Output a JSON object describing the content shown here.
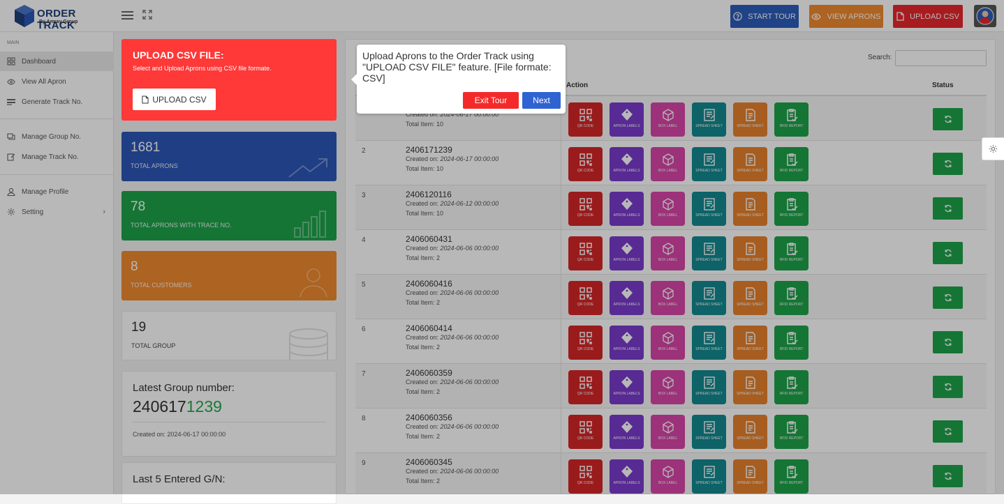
{
  "brand": {
    "title": "ORDER TRACK",
    "subtitle": "By Amray Group"
  },
  "topbar": {
    "start_tour": "START TOUR",
    "view_aprons": "VIEW APRONS",
    "upload_csv": "UPLOAD CSV",
    "colors": {
      "start": "#2b5dba",
      "view": "#f08a2e",
      "upload": "#e8272d"
    }
  },
  "sidebar": {
    "section": "MAIN",
    "items": [
      {
        "label": "Dashboard",
        "icon": "grid-icon"
      },
      {
        "label": "View All Apron",
        "icon": "eye-icon"
      },
      {
        "label": "Generate Track No.",
        "icon": "list-icon"
      },
      {
        "label": "Manage Group No.",
        "icon": "layers-icon"
      },
      {
        "label": "Manage Track No.",
        "icon": "edit-icon"
      },
      {
        "label": "Manage Profile",
        "icon": "user-icon"
      },
      {
        "label": "Setting",
        "icon": "gear-icon"
      }
    ]
  },
  "upload_card": {
    "title": "UPLOAD CSV FILE:",
    "subtitle": "Select and Upload Aprons using CSV file formate.",
    "button": "UPLOAD CSV"
  },
  "stats": [
    {
      "value": "1681",
      "label": "TOTAL APRONS",
      "color": "#2d56b8"
    },
    {
      "value": "78",
      "label": "TOTAL APRONS WITH TRACE NO.",
      "color": "#1ea34a"
    },
    {
      "value": "8",
      "label": "TOTAL CUSTOMERS",
      "color": "#f08a2e"
    },
    {
      "value": "19",
      "label": "TOTAL GROUP",
      "color": "#ffffff"
    }
  ],
  "latest_group": {
    "title": "Latest Group number:",
    "prefix": "240617",
    "suffix": "1239",
    "created": "Created on: 2024-06-17 00:00:00"
  },
  "last_five": {
    "title": "Last 5 Entered G/N:"
  },
  "table": {
    "search_label": "Search:",
    "search_value": "",
    "headers": {
      "action": "Action",
      "status": "Status"
    },
    "action_labels": [
      "QR CODE",
      "APRON LABELS",
      "BOX LABEL",
      "SPREAD SHEET",
      "SPREAD SHEET",
      "RFID REPORT"
    ],
    "created_prefix": "Created on: ",
    "total_prefix": "Total Item: ",
    "rows": [
      {
        "idx": "",
        "group": "",
        "created": "2024-06-17 00:00:00",
        "total": "10"
      },
      {
        "idx": "2",
        "group": "2406171239",
        "created": "2024-06-17 00:00:00",
        "total": "10"
      },
      {
        "idx": "3",
        "group": "2406120116",
        "created": "2024-06-12 00:00:00",
        "total": "10"
      },
      {
        "idx": "4",
        "group": "2406060431",
        "created": "2024-06-06 00:00:00",
        "total": "2"
      },
      {
        "idx": "5",
        "group": "2406060416",
        "created": "2024-06-06 00:00:00",
        "total": "2"
      },
      {
        "idx": "6",
        "group": "2406060414",
        "created": "2024-06-06 00:00:00",
        "total": "2"
      },
      {
        "idx": "7",
        "group": "2406060359",
        "created": "2024-06-06 00:00:00",
        "total": "2"
      },
      {
        "idx": "8",
        "group": "2406060356",
        "created": "2024-06-06 00:00:00",
        "total": "2"
      },
      {
        "idx": "9",
        "group": "2406060345",
        "created": "2024-06-06 00:00:00",
        "total": "2"
      }
    ]
  },
  "tour": {
    "text": "Upload Aprons to the Order Track using \"UPLOAD CSV FILE\" feature. [File formate: CSV]",
    "exit": "Exit Tour",
    "next": "Next"
  }
}
